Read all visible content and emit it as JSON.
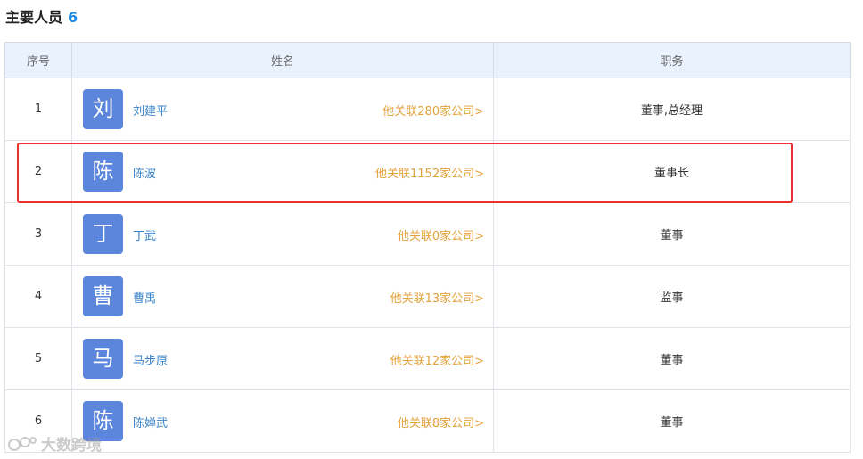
{
  "section": {
    "title": "主要人员",
    "count": "6"
  },
  "table": {
    "headers": {
      "index": "序号",
      "name": "姓名",
      "role": "职务"
    },
    "rows": [
      {
        "index": "1",
        "avatar": "刘",
        "name": "刘建平",
        "related": "他关联280家公司>",
        "role": "董事,总经理"
      },
      {
        "index": "2",
        "avatar": "陈",
        "name": "陈波",
        "related": "他关联1152家公司>",
        "role": "董事长"
      },
      {
        "index": "3",
        "avatar": "丁",
        "name": "丁武",
        "related": "他关联0家公司>",
        "role": "董事"
      },
      {
        "index": "4",
        "avatar": "曹",
        "name": "曹禹",
        "related": "他关联13家公司>",
        "role": "监事"
      },
      {
        "index": "5",
        "avatar": "马",
        "name": "马步原",
        "related": "他关联12家公司>",
        "role": "董事"
      },
      {
        "index": "6",
        "avatar": "陈",
        "name": "陈婵武",
        "related": "他关联8家公司>",
        "role": "董事"
      }
    ]
  },
  "highlight": {
    "row_index": "2",
    "color": "#e8322c"
  },
  "watermark": {
    "text": "大数跨境"
  },
  "colors": {
    "accent": "#1b8ae6",
    "avatar_bg": "#5b86dc",
    "name_link": "#3a82c8",
    "related_link": "#e3a23c",
    "header_bg": "#e9f2fd"
  }
}
